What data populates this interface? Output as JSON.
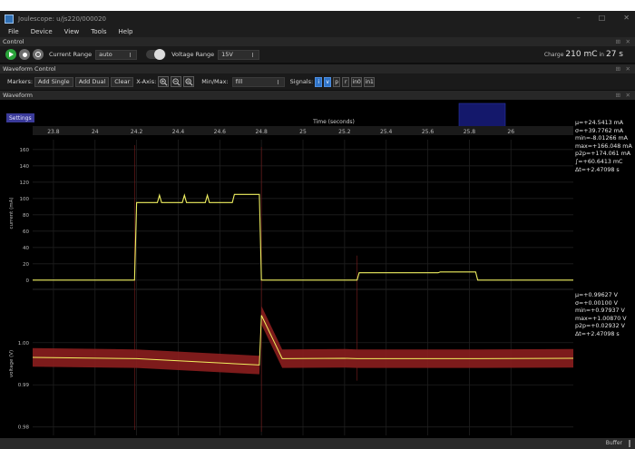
{
  "window": {
    "title": "Joulescope: u/js220/000020",
    "minimize": "–",
    "maximize": "□",
    "close": "✕"
  },
  "menu": [
    "File",
    "Device",
    "View",
    "Tools",
    "Help"
  ],
  "control": {
    "header": "Control",
    "current_range_label": "Current Range",
    "current_range_value": "auto",
    "voltage_range_label": "Voltage Range",
    "voltage_range_value": "15V",
    "charge_prefix": "Charge",
    "charge_value": "210 mC",
    "charge_in": "in",
    "charge_time": "27 s"
  },
  "waveform_control": {
    "header": "Waveform Control",
    "markers_label": "Markers:",
    "add_single": "Add Single",
    "add_dual": "Add Dual",
    "clear": "Clear",
    "xaxis_label": "X-Axis:",
    "minmax_label": "Min/Max:",
    "minmax_value": "fill",
    "signals_label": "Signals:",
    "signals": [
      {
        "label": "i",
        "active": true
      },
      {
        "label": "v",
        "active": true
      },
      {
        "label": "p",
        "active": false
      },
      {
        "label": "r",
        "active": false
      },
      {
        "label": "in0",
        "active": false
      },
      {
        "label": "in1",
        "active": false
      }
    ]
  },
  "waveform": {
    "header": "Waveform",
    "settings_label": "Settings",
    "xaxis_title": "Time (seconds)",
    "current_axis_label": "current (mA)",
    "voltage_axis_label": "voltage (V)",
    "current_stats": [
      "μ=+24.5413 mA",
      "σ=+39.7762 mA",
      "min=-8.01266 mA",
      "max=+166.048 mA",
      "p2p=+174.061 mA",
      "∫=+60.6413 mC",
      "Δt=+2.47098 s"
    ],
    "voltage_stats": [
      "μ=+0.99627 V",
      "σ=+0.00100 V",
      "min=+0.97937 V",
      "max=+1.00870 V",
      "p2p=+0.02932 V",
      "Δt=+2.47098 s"
    ]
  },
  "status": {
    "buffer_label": "Buffer"
  },
  "colors": {
    "current_trace": "#f0f060",
    "voltage_band": "#8b1e1e",
    "voltage_trace": "#f0f060",
    "accent": "#2f73c8"
  },
  "chart_data": [
    {
      "type": "line",
      "xlabel": "Time (seconds)",
      "ylabel": "current (mA)",
      "x_ticks": [
        "23.8",
        "24",
        "24.2",
        "24.4",
        "24.6",
        "24.8",
        "25",
        "25.2",
        "25.4",
        "25.6",
        "25.8",
        "26"
      ],
      "y_ticks": [
        "0",
        "20",
        "40",
        "60",
        "80",
        "100",
        "120",
        "140",
        "160"
      ],
      "xlim": [
        23.7,
        26.3
      ],
      "ylim": [
        -8,
        172
      ],
      "grid": true,
      "series": [
        {
          "points": [
            [
              23.7,
              0
            ],
            [
              24.19,
              0
            ],
            [
              24.2,
              95
            ],
            [
              24.3,
              95
            ],
            [
              24.31,
              104
            ],
            [
              24.32,
              95
            ],
            [
              24.42,
              95
            ],
            [
              24.43,
              104
            ],
            [
              24.44,
              95
            ],
            [
              24.53,
              95
            ],
            [
              24.54,
              104
            ],
            [
              24.55,
              95
            ],
            [
              24.66,
              95
            ],
            [
              24.67,
              105
            ],
            [
              24.79,
              105
            ],
            [
              24.8,
              0
            ],
            [
              25.26,
              0
            ],
            [
              25.27,
              9
            ],
            [
              25.65,
              9
            ],
            [
              25.66,
              10
            ],
            [
              25.83,
              10
            ],
            [
              25.84,
              0
            ],
            [
              26.3,
              0
            ]
          ]
        }
      ]
    },
    {
      "type": "line",
      "xlabel": "Time (seconds)",
      "ylabel": "voltage (V)",
      "y_ticks": [
        "0.98",
        "0.99",
        "1.00"
      ],
      "xlim": [
        23.7,
        26.3
      ],
      "ylim": [
        0.978,
        1.012
      ],
      "grid": true,
      "series": [
        {
          "points": [
            [
              23.7,
              0.9965
            ],
            [
              24.2,
              0.9962
            ],
            [
              24.79,
              0.9947
            ],
            [
              24.8,
              1.0065
            ],
            [
              24.9,
              0.9962
            ],
            [
              25.2,
              0.9963
            ],
            [
              25.26,
              0.9962
            ],
            [
              25.85,
              0.9962
            ],
            [
              26.3,
              0.9963
            ]
          ]
        }
      ]
    }
  ]
}
